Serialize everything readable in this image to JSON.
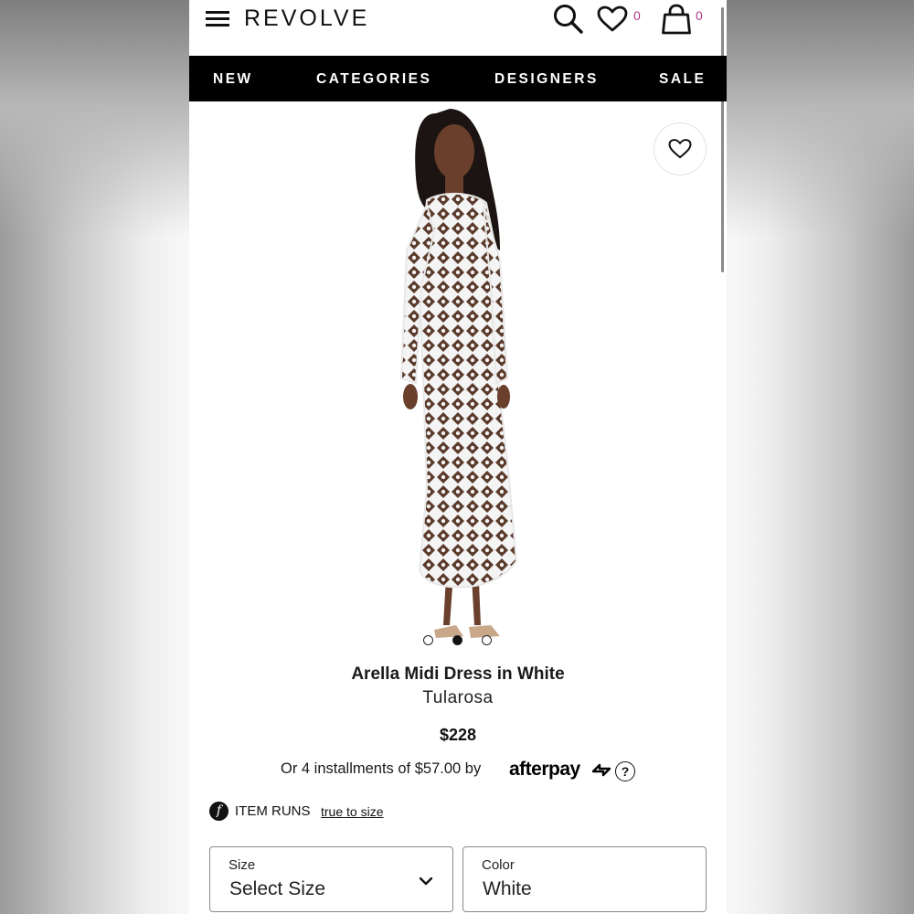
{
  "header": {
    "logo": "REVOLVE",
    "wishlist_count": "0",
    "bag_count": "0"
  },
  "nav": {
    "items": [
      "NEW",
      "CATEGORIES",
      "DESIGNERS",
      "SALE"
    ]
  },
  "carousel": {
    "slide_count": 3,
    "active_index": 1
  },
  "product": {
    "title": "Arella Midi Dress in White",
    "brand": "Tularosa",
    "price": "$228",
    "installments_text": "Or 4 installments of $57.00 by",
    "afterpay_label": "afterpay",
    "help_label": "?",
    "fit_icon": "f",
    "fit_label": "ITEM RUNS",
    "fit_link": "true to size"
  },
  "selectors": {
    "size": {
      "label": "Size",
      "value": "Select Size"
    },
    "color": {
      "label": "Color",
      "value": "White"
    }
  },
  "colors": {
    "brand_count": "#b0388d",
    "nav_bg": "#000000"
  }
}
